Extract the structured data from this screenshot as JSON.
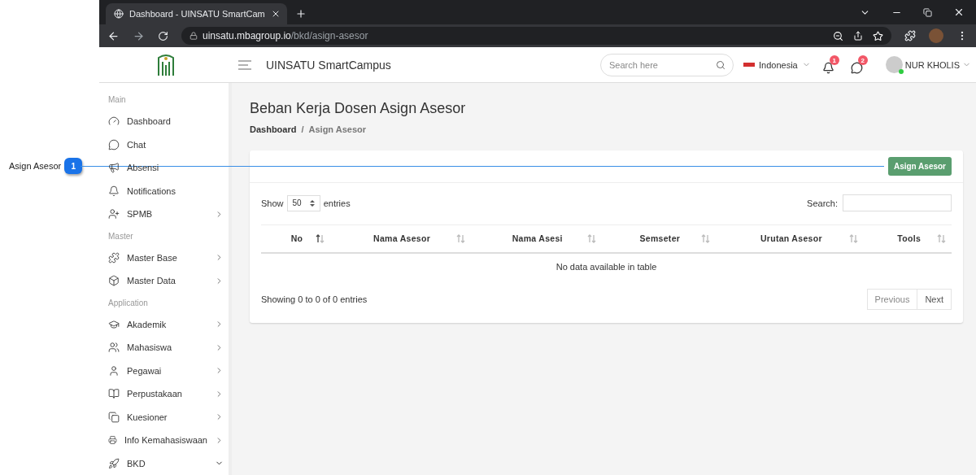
{
  "annotation": {
    "label": "Asign Asesor",
    "number": "1"
  },
  "browser": {
    "tab_title": "Dashboard - UINSATU SmartCam",
    "url_host": "uinsatu.mbagroup.io",
    "url_path": "/bkd/asign-asesor"
  },
  "header": {
    "app_title": "UINSATU SmartCampus",
    "search": {
      "placeholder": "Search here"
    },
    "language": "Indonesia",
    "notifications_count": "1",
    "messages_count": "2",
    "user": {
      "name": "NUR KHOLIS",
      "online": true
    }
  },
  "sidebar": {
    "items": [
      {
        "kind": "section",
        "label": "Main"
      },
      {
        "kind": "link",
        "label": "Dashboard"
      },
      {
        "kind": "link",
        "label": "Chat"
      },
      {
        "kind": "link",
        "label": "Absensi"
      },
      {
        "kind": "link",
        "label": "Notifications"
      },
      {
        "kind": "menu",
        "label": "SPMB",
        "expanded": false
      },
      {
        "kind": "section",
        "label": "Master"
      },
      {
        "kind": "menu",
        "label": "Master Base",
        "expanded": false
      },
      {
        "kind": "menu",
        "label": "Master Data",
        "expanded": false
      },
      {
        "kind": "section",
        "label": "Application"
      },
      {
        "kind": "menu",
        "label": "Akademik",
        "expanded": false
      },
      {
        "kind": "menu",
        "label": "Mahasiswa",
        "expanded": false
      },
      {
        "kind": "menu",
        "label": "Pegawai",
        "expanded": false
      },
      {
        "kind": "menu",
        "label": "Perpustakaan",
        "expanded": false
      },
      {
        "kind": "menu",
        "label": "Kuesioner",
        "expanded": false
      },
      {
        "kind": "menu",
        "label": "Info Kemahasiswaan",
        "expanded": false
      },
      {
        "kind": "menu",
        "label": "BKD",
        "expanded": true
      }
    ]
  },
  "page": {
    "title": "Beban Kerja Dosen Asign Asesor",
    "breadcrumb": [
      {
        "label": "Dashboard",
        "current": false
      },
      {
        "label": "Asign Asesor",
        "current": true
      }
    ],
    "breadcrumb_separator": "/"
  },
  "card": {
    "action_button": "Asign Asesor",
    "length_menu": {
      "before": "Show",
      "value": "50",
      "after": "entries"
    },
    "search_label": "Search:",
    "table": {
      "columns": [
        {
          "label": "No",
          "sorted": true
        },
        {
          "label": "Nama Asesor",
          "sorted": false
        },
        {
          "label": "Nama Asesi",
          "sorted": false
        },
        {
          "label": "Semseter",
          "sorted": false
        },
        {
          "label": "Urutan Asesor",
          "sorted": false
        },
        {
          "label": "Tools",
          "sorted": false
        }
      ],
      "empty_message": "No data available in table"
    },
    "info": "Showing 0 to 0 of 0 entries",
    "pagination": [
      {
        "label": "Previous",
        "disabled": true
      },
      {
        "label": "Next",
        "disabled": false
      }
    ]
  }
}
